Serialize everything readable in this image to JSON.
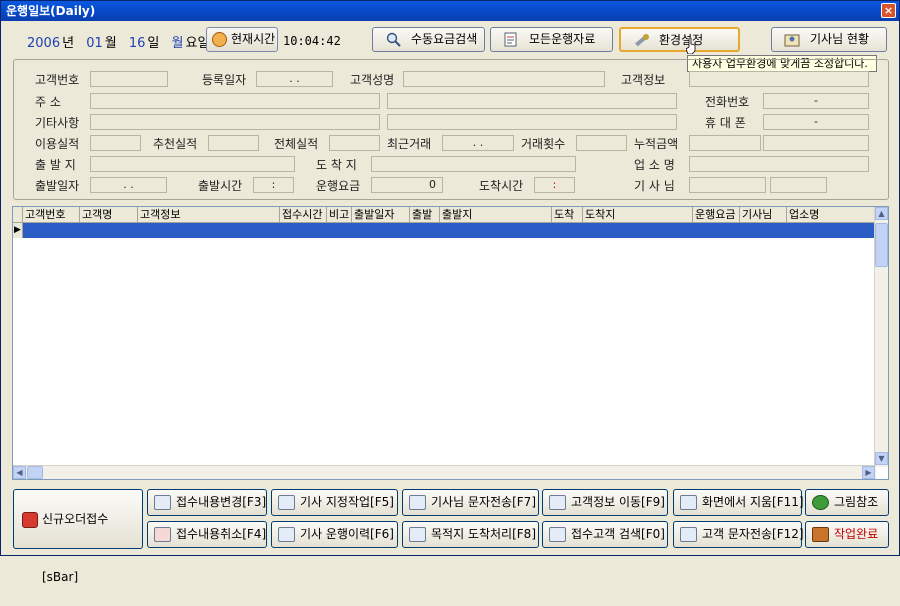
{
  "window": {
    "title": "운행일보(Daily)",
    "close": "×"
  },
  "header": {
    "year": "2006",
    "year_unit": "년",
    "month": "01",
    "month_unit": "월",
    "day": "16",
    "day_unit": "일",
    "dow": "월",
    "dow_unit": "요일",
    "now_button": "현재시간",
    "time": "10:04:42"
  },
  "toolbar": {
    "manual_fare": "수동요금검색",
    "all_data": "모든운행자료",
    "settings": "환경설정",
    "drivers": "기사님 현황",
    "tooltip": "사용자 업무환경에 맞게끔 조정합니다."
  },
  "form": {
    "labels": {
      "cust_no": "고객번호",
      "reg_date": "등록일자",
      "cust_name": "고객성명",
      "cust_info": "고객정보",
      "address": "주    소",
      "phone": "전화번호",
      "other": "기타사항",
      "mobile": "휴 대 폰",
      "usage": "이용실적",
      "recommend": "추천실적",
      "total": "전체실적",
      "recent": "최근거래",
      "count": "거래횟수",
      "accum": "누적금액",
      "origin": "출 발 지",
      "dest": "도 착 지",
      "business": "업 소 명",
      "dep_date": "출발일자",
      "dep_time": "출발시간",
      "fare": "운행요금",
      "arr_time": "도착시간",
      "driver": "기 사 님"
    },
    "values": {
      "reg_date": ". .",
      "phone": "-",
      "mobile": "-",
      "recent": ". .",
      "dep_date": ". .",
      "dep_time": ":",
      "fare": "0",
      "arr_time": ":"
    }
  },
  "grid": {
    "columns": [
      "고객번호",
      "고객명",
      "고객정보",
      "접수시간",
      "비고",
      "출발일자",
      "출발",
      "출발지",
      "도착",
      "도착지",
      "운행요금",
      "기사님",
      "업소명"
    ],
    "row_indicator": "▶"
  },
  "bottom": {
    "new_order": "신규오더접수[sBar]",
    "edit": "접수내용변경[F3]",
    "assign": "기사 지정작업[F5]",
    "sms_driver": "기사님 문자전송[F7]",
    "move_info": "고객정보 이동[F9]",
    "clear": "화면에서 지움[F11]",
    "picture": "그림참조",
    "cancel": "접수내용취소[F4]",
    "history": "기사 운행이력[F6]",
    "arrival": "목적지 도착처리[F8]",
    "search_cust": "접수고객 검색[F0]",
    "sms_cust": "고객 문자전송[F12]",
    "done": "작업완료"
  },
  "colors": {
    "title": "#0A58E0",
    "selection": "#2C5DC6",
    "date": "#1E40B4"
  }
}
